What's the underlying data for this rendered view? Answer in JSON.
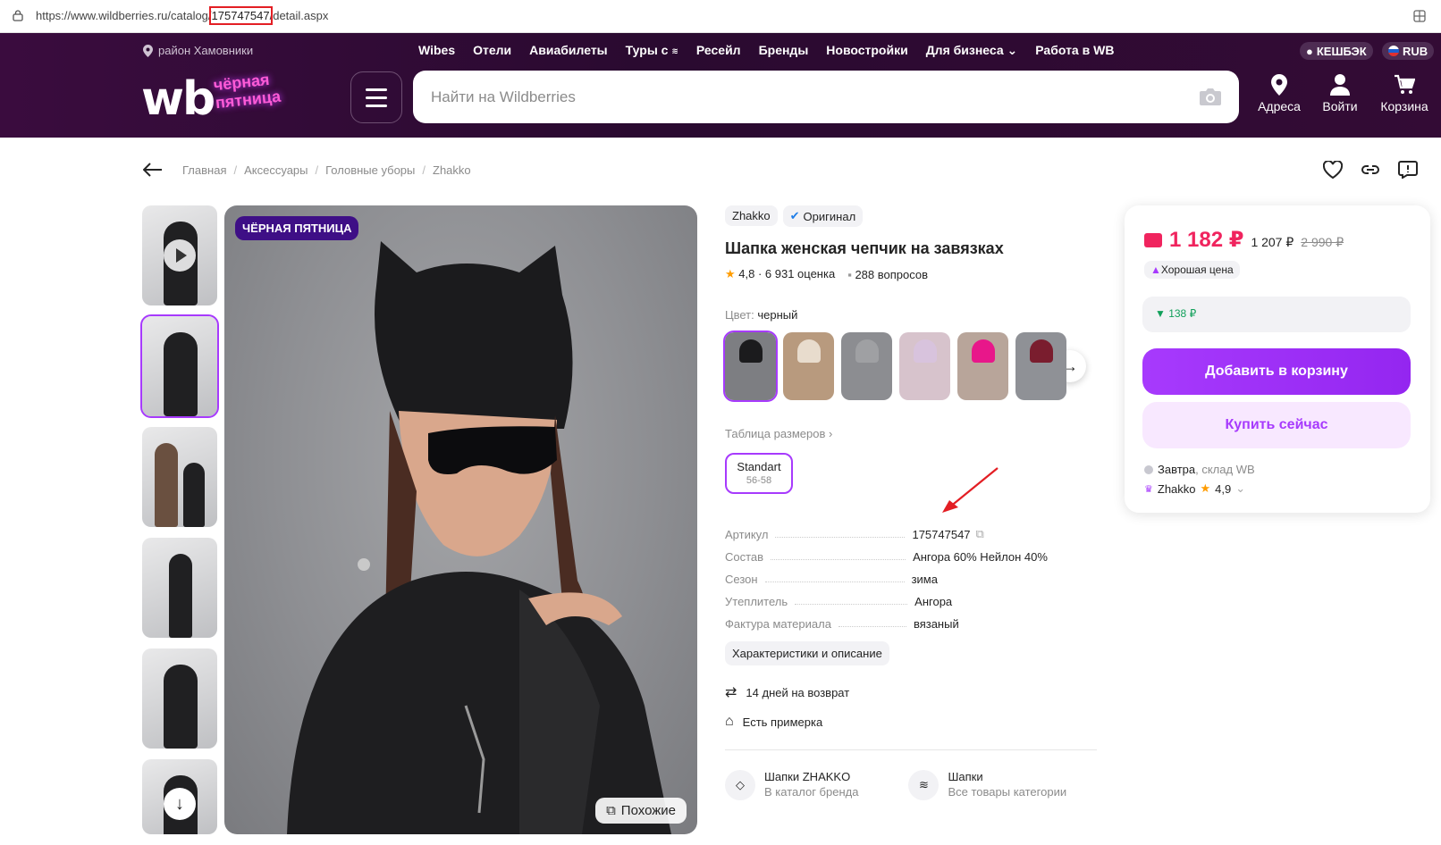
{
  "browser": {
    "url_prefix": "https://www.wildberries.ru/catalog/",
    "url_article": "175747547",
    "url_suffix": "/detail.aspx"
  },
  "header": {
    "location": "район Хамовники",
    "nav": [
      "Wibes",
      "Отели",
      "Авиабилеты",
      "Туры с",
      "Ресейл",
      "Бренды",
      "Новостройки",
      "Для бизнеса",
      "Работа в WB"
    ],
    "cashback_label": "КЕШБЭК",
    "currency_label": "RUB",
    "logo_text": "wb",
    "logo_subtext": "чёрная пятница",
    "search_placeholder": "Найти на Wildberries",
    "addresses_label": "Адреса",
    "login_label": "Войти",
    "cart_label": "Корзина"
  },
  "breadcrumbs": [
    "Главная",
    "Аксессуары",
    "Головные уборы",
    "Zhakko"
  ],
  "gallery": {
    "badge": "ЧЁРНАЯ ПЯТНИЦА",
    "similar_label": "Похожие"
  },
  "product": {
    "brand": "Zhakko",
    "original_label": "Оригинал",
    "title": "Шапка женская чепчик на завязках",
    "rating": "4,8 · 6 931 оценка",
    "questions": "288 вопросов",
    "color_label": "Цвет:",
    "color_value": "черный",
    "size_table_label": "Таблица размеров",
    "size_name": "Standart",
    "size_range": "56-58",
    "params": [
      {
        "k": "Артикул",
        "v": "175747547"
      },
      {
        "k": "Состав",
        "v": "Ангора 60% Нейлон 40%"
      },
      {
        "k": "Сезон",
        "v": "зима"
      },
      {
        "k": "Утеплитель",
        "v": "Ангора"
      },
      {
        "k": "Фактура материала",
        "v": "вязаный"
      }
    ],
    "desc_button": "Характеристики и описание",
    "return_text": "14 дней на возврат",
    "fitting_text": "Есть примерка",
    "brand_link_title": "Шапки ZHAKKO",
    "brand_link_sub": "В каталог бренда",
    "cat_link_title": "Шапки",
    "cat_link_sub": "Все товары категории"
  },
  "buybox": {
    "price": "1 182 ₽",
    "price_no_wallet": "1 207 ₽",
    "old_price": "2 990 ₽",
    "good_price": "Хорошая цена",
    "wallet_saving": "▼ 138 ₽",
    "add_to_cart": "Добавить в корзину",
    "buy_now": "Купить сейчас",
    "delivery_when": "Завтра",
    "delivery_where": ", склад WB",
    "seller": "Zhakko",
    "seller_rating": "4,9"
  },
  "colors": {
    "accent": "#a73afd",
    "price": "#f0245e",
    "header_bg": "#2a0a30"
  }
}
